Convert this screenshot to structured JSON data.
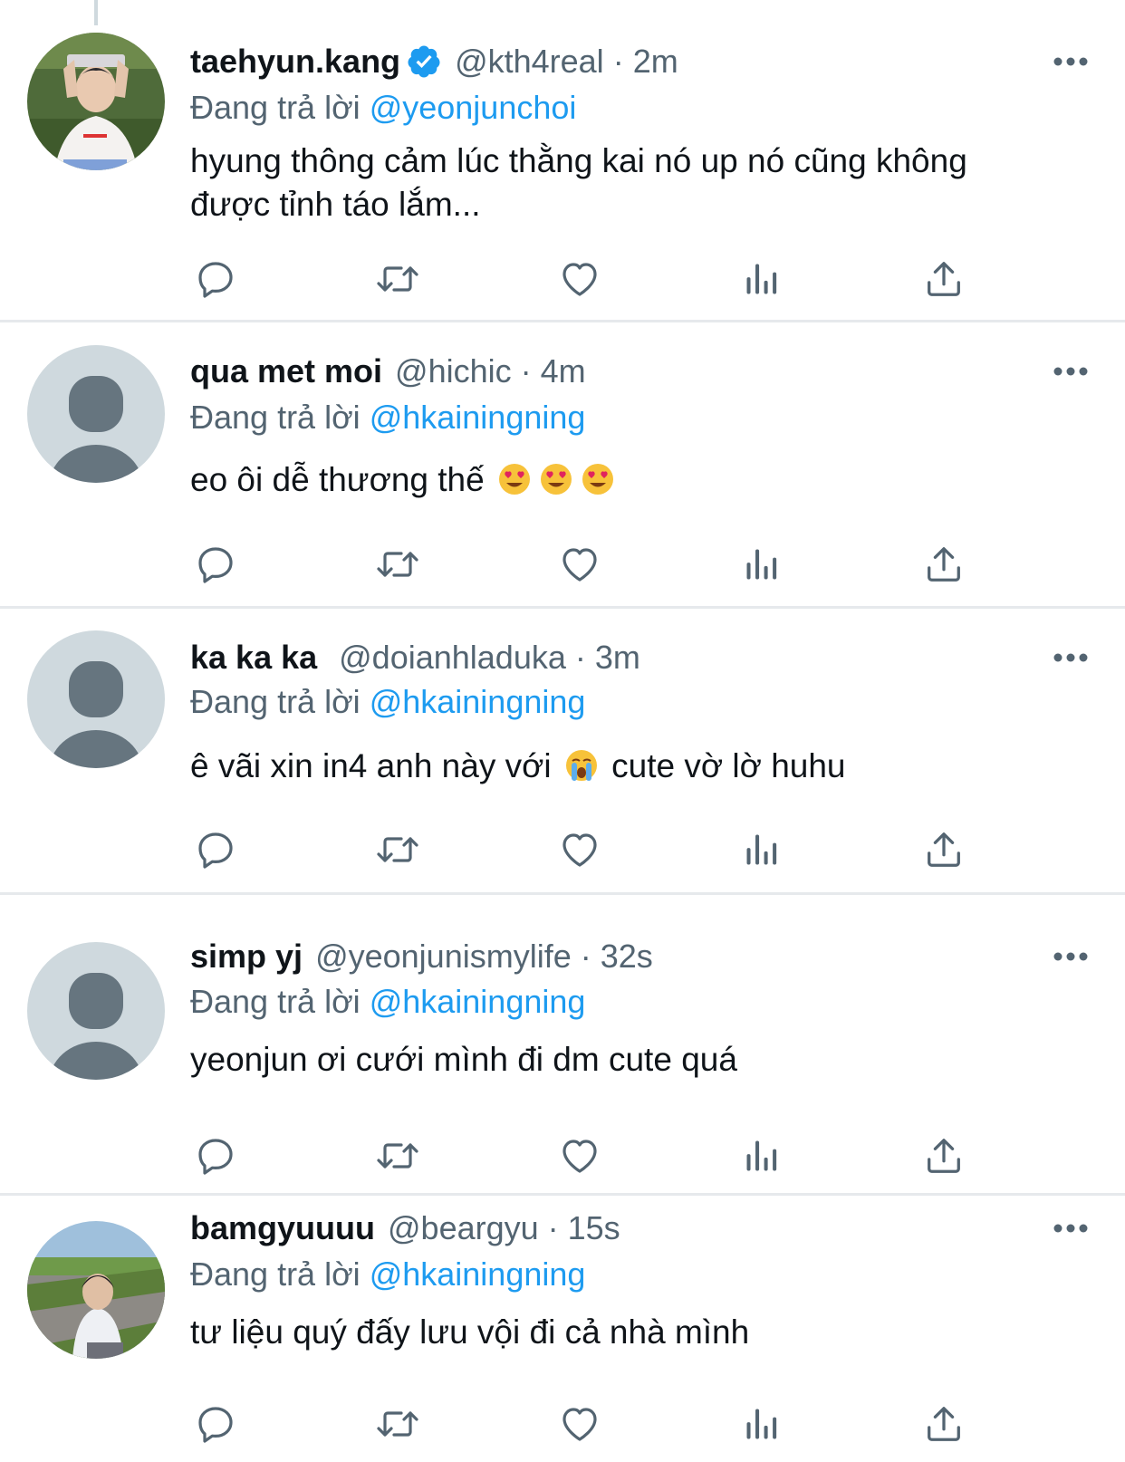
{
  "replying_prefix": "Đang trả lời",
  "tweets": [
    {
      "name": "taehyun.kang",
      "verified": true,
      "handle": "@kth4real",
      "time": "2m",
      "reply_to": "@yeonjunchoi",
      "text": "hyung thông cảm lúc thằng kai nó up nó cũng không\nđược tỉnh táo lắm..."
    },
    {
      "name": "qua met moi",
      "handle": "@hichic",
      "time": "4m",
      "reply_to": "@hkainingning",
      "text_before": "eo ôi dễ thương thế",
      "text_after": ""
    },
    {
      "name": "ka ka ka",
      "handle": "@doianhladuka",
      "time": "3m",
      "reply_to": "@hkainingning",
      "text_before": "ê vãi xin in4 anh này với",
      "text_after": "cute vờ lờ huhu"
    },
    {
      "name": "simp yj",
      "handle": "@yeonjunismylife",
      "time": "32s",
      "reply_to": "@hkainingning",
      "text": "yeonjun ơi cưới mình đi dm cute quá"
    },
    {
      "name": "bamgyuuuu",
      "handle": "@beargyu",
      "time": "15s",
      "reply_to": "@hkainingning",
      "text": "tư liệu quý đấy lưu vội đi cả nhà mình"
    }
  ],
  "colors": {
    "text": "#0f1419",
    "secondary": "#536471",
    "link": "#1d9bf0",
    "divider": "#e6e9ec",
    "default_avatar_bg": "#cfd9de",
    "default_avatar_fg": "#66757f"
  },
  "icons": [
    "reply-icon",
    "retweet-icon",
    "like-icon",
    "analytics-icon",
    "share-icon",
    "more-icon",
    "verified-icon"
  ]
}
